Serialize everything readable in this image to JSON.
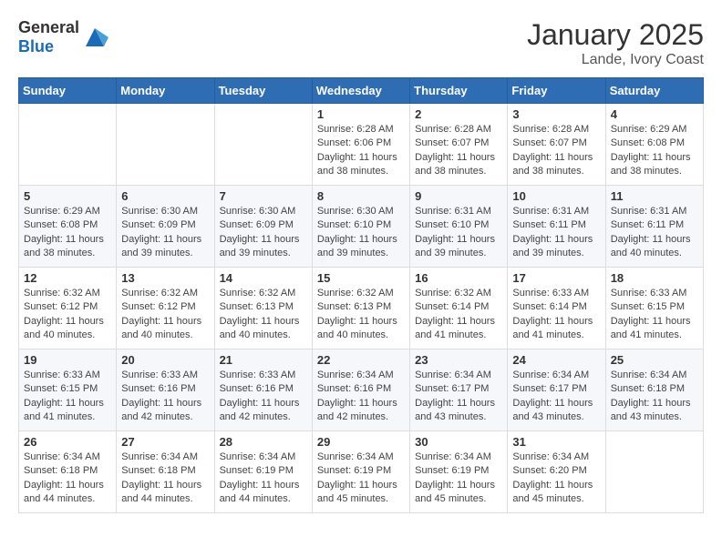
{
  "header": {
    "logo_general": "General",
    "logo_blue": "Blue",
    "month": "January 2025",
    "location": "Lande, Ivory Coast"
  },
  "weekdays": [
    "Sunday",
    "Monday",
    "Tuesday",
    "Wednesday",
    "Thursday",
    "Friday",
    "Saturday"
  ],
  "weeks": [
    [
      {
        "day": "",
        "info": ""
      },
      {
        "day": "",
        "info": ""
      },
      {
        "day": "",
        "info": ""
      },
      {
        "day": "1",
        "info": "Sunrise: 6:28 AM\nSunset: 6:06 PM\nDaylight: 11 hours and 38 minutes."
      },
      {
        "day": "2",
        "info": "Sunrise: 6:28 AM\nSunset: 6:07 PM\nDaylight: 11 hours and 38 minutes."
      },
      {
        "day": "3",
        "info": "Sunrise: 6:28 AM\nSunset: 6:07 PM\nDaylight: 11 hours and 38 minutes."
      },
      {
        "day": "4",
        "info": "Sunrise: 6:29 AM\nSunset: 6:08 PM\nDaylight: 11 hours and 38 minutes."
      }
    ],
    [
      {
        "day": "5",
        "info": "Sunrise: 6:29 AM\nSunset: 6:08 PM\nDaylight: 11 hours and 38 minutes."
      },
      {
        "day": "6",
        "info": "Sunrise: 6:30 AM\nSunset: 6:09 PM\nDaylight: 11 hours and 39 minutes."
      },
      {
        "day": "7",
        "info": "Sunrise: 6:30 AM\nSunset: 6:09 PM\nDaylight: 11 hours and 39 minutes."
      },
      {
        "day": "8",
        "info": "Sunrise: 6:30 AM\nSunset: 6:10 PM\nDaylight: 11 hours and 39 minutes."
      },
      {
        "day": "9",
        "info": "Sunrise: 6:31 AM\nSunset: 6:10 PM\nDaylight: 11 hours and 39 minutes."
      },
      {
        "day": "10",
        "info": "Sunrise: 6:31 AM\nSunset: 6:11 PM\nDaylight: 11 hours and 39 minutes."
      },
      {
        "day": "11",
        "info": "Sunrise: 6:31 AM\nSunset: 6:11 PM\nDaylight: 11 hours and 40 minutes."
      }
    ],
    [
      {
        "day": "12",
        "info": "Sunrise: 6:32 AM\nSunset: 6:12 PM\nDaylight: 11 hours and 40 minutes."
      },
      {
        "day": "13",
        "info": "Sunrise: 6:32 AM\nSunset: 6:12 PM\nDaylight: 11 hours and 40 minutes."
      },
      {
        "day": "14",
        "info": "Sunrise: 6:32 AM\nSunset: 6:13 PM\nDaylight: 11 hours and 40 minutes."
      },
      {
        "day": "15",
        "info": "Sunrise: 6:32 AM\nSunset: 6:13 PM\nDaylight: 11 hours and 40 minutes."
      },
      {
        "day": "16",
        "info": "Sunrise: 6:32 AM\nSunset: 6:14 PM\nDaylight: 11 hours and 41 minutes."
      },
      {
        "day": "17",
        "info": "Sunrise: 6:33 AM\nSunset: 6:14 PM\nDaylight: 11 hours and 41 minutes."
      },
      {
        "day": "18",
        "info": "Sunrise: 6:33 AM\nSunset: 6:15 PM\nDaylight: 11 hours and 41 minutes."
      }
    ],
    [
      {
        "day": "19",
        "info": "Sunrise: 6:33 AM\nSunset: 6:15 PM\nDaylight: 11 hours and 41 minutes."
      },
      {
        "day": "20",
        "info": "Sunrise: 6:33 AM\nSunset: 6:16 PM\nDaylight: 11 hours and 42 minutes."
      },
      {
        "day": "21",
        "info": "Sunrise: 6:33 AM\nSunset: 6:16 PM\nDaylight: 11 hours and 42 minutes."
      },
      {
        "day": "22",
        "info": "Sunrise: 6:34 AM\nSunset: 6:16 PM\nDaylight: 11 hours and 42 minutes."
      },
      {
        "day": "23",
        "info": "Sunrise: 6:34 AM\nSunset: 6:17 PM\nDaylight: 11 hours and 43 minutes."
      },
      {
        "day": "24",
        "info": "Sunrise: 6:34 AM\nSunset: 6:17 PM\nDaylight: 11 hours and 43 minutes."
      },
      {
        "day": "25",
        "info": "Sunrise: 6:34 AM\nSunset: 6:18 PM\nDaylight: 11 hours and 43 minutes."
      }
    ],
    [
      {
        "day": "26",
        "info": "Sunrise: 6:34 AM\nSunset: 6:18 PM\nDaylight: 11 hours and 44 minutes."
      },
      {
        "day": "27",
        "info": "Sunrise: 6:34 AM\nSunset: 6:18 PM\nDaylight: 11 hours and 44 minutes."
      },
      {
        "day": "28",
        "info": "Sunrise: 6:34 AM\nSunset: 6:19 PM\nDaylight: 11 hours and 44 minutes."
      },
      {
        "day": "29",
        "info": "Sunrise: 6:34 AM\nSunset: 6:19 PM\nDaylight: 11 hours and 45 minutes."
      },
      {
        "day": "30",
        "info": "Sunrise: 6:34 AM\nSunset: 6:19 PM\nDaylight: 11 hours and 45 minutes."
      },
      {
        "day": "31",
        "info": "Sunrise: 6:34 AM\nSunset: 6:20 PM\nDaylight: 11 hours and 45 minutes."
      },
      {
        "day": "",
        "info": ""
      }
    ]
  ]
}
